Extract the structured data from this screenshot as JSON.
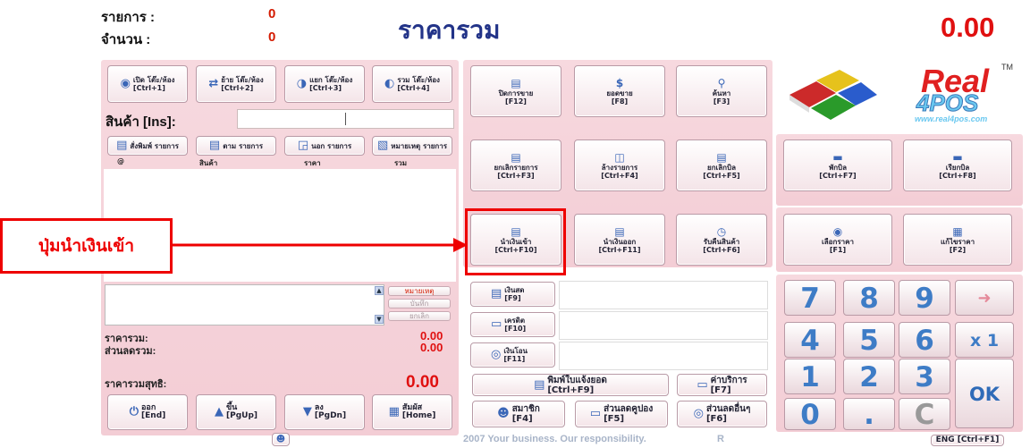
{
  "header": {
    "items_label": "รายการ :",
    "items_value": "0",
    "qty_label": "จำนวน :",
    "qty_value": "0",
    "title": "ราคารวม",
    "total": "0.00"
  },
  "top_buttons": [
    {
      "label": "เปิด โต๊ะ/ห้อง",
      "key": "[Ctrl+1]",
      "icon": "open-table-icon",
      "glyph": "◉"
    },
    {
      "label": "ย้าย โต๊ะ/ห้อง",
      "key": "[Ctrl+2]",
      "icon": "move-table-icon",
      "glyph": "⇄"
    },
    {
      "label": "แยก โต๊ะ/ห้อง",
      "key": "[Ctrl+3]",
      "icon": "split-table-icon",
      "glyph": "◑"
    },
    {
      "label": "รวม โต๊ะ/ห้อง",
      "key": "[Ctrl+4]",
      "icon": "merge-table-icon",
      "glyph": "◐"
    }
  ],
  "product": {
    "label": "สินค้า [Ins]:"
  },
  "list_buttons": [
    {
      "label": "สั่งพิมพ์ รายการ",
      "icon": "print-list-icon",
      "glyph": "▤"
    },
    {
      "label": "ตาม รายการ",
      "icon": "follow-list-icon",
      "glyph": "▤"
    },
    {
      "label": "นอก รายการ",
      "icon": "outside-list-icon",
      "glyph": "◲"
    },
    {
      "label": "หมายเหตุ รายการ",
      "icon": "note-list-icon",
      "glyph": "▧"
    }
  ],
  "columns": [
    "@",
    "สินค้า",
    "ราคา",
    "รวม"
  ],
  "note_buttons": {
    "note": "หมายเหตุ",
    "save": "บันทึก",
    "cancel": "ยกเลิก"
  },
  "summary": {
    "total_label": "ราคารวม:",
    "total": "0.00",
    "discount_label": "ส่วนลดรวม:",
    "discount": "0.00",
    "net_label": "ราคารวมสุทธิ:",
    "net": "0.00"
  },
  "bottom_buttons": [
    {
      "label": "ออก",
      "key": "[End]",
      "icon": "exit-icon",
      "glyph": "⏻"
    },
    {
      "label": "ขึ้น",
      "key": "[PgUp]",
      "icon": "up-arrow-icon",
      "glyph": "▲"
    },
    {
      "label": "ลง",
      "key": "[PgDn]",
      "icon": "down-arrow-icon",
      "glyph": "▼"
    },
    {
      "label": "สัมผัส",
      "key": "[Home]",
      "icon": "touch-icon",
      "glyph": "▦"
    }
  ],
  "function_rows": [
    [
      {
        "label": "ปิดการขาย",
        "key": "[F12]",
        "icon": "close-sale-icon",
        "glyph": "▤"
      },
      {
        "label": "ยอดขาย",
        "key": "[F8]",
        "icon": "sales-total-icon",
        "glyph": "$"
      },
      {
        "label": "ค้นหา",
        "key": "[F3]",
        "icon": "search-icon",
        "glyph": "⚲"
      }
    ],
    [
      {
        "label": "ยกเลิกรายการ",
        "key": "[Ctrl+F3]",
        "icon": "cancel-item-icon",
        "glyph": "▤"
      },
      {
        "label": "ล้างรายการ",
        "key": "[Ctrl+F4]",
        "icon": "clear-list-icon",
        "glyph": "◫"
      },
      {
        "label": "ยกเลิกบิล",
        "key": "[Ctrl+F5]",
        "icon": "cancel-bill-icon",
        "glyph": "▤"
      }
    ],
    [
      {
        "label": "นำเงินเข้า",
        "key": "[Ctrl+F10]",
        "icon": "cash-in-icon",
        "glyph": "▤"
      },
      {
        "label": "นำเงินออก",
        "key": "[Ctrl+F11]",
        "icon": "cash-out-icon",
        "glyph": "▤"
      },
      {
        "label": "รับคืนสินค้า",
        "key": "[Ctrl+F6]",
        "icon": "return-goods-icon",
        "glyph": "◷"
      }
    ]
  ],
  "bill_buttons": [
    {
      "label": "พักบิล",
      "key": "[Ctrl+F7]",
      "icon": "hold-bill-icon",
      "glyph": "▬"
    },
    {
      "label": "เรียกบิล",
      "key": "[Ctrl+F8]",
      "icon": "recall-bill-icon",
      "glyph": "▬"
    }
  ],
  "price_buttons": [
    {
      "label": "เลือกราคา",
      "key": "[F1]",
      "icon": "choose-price-icon",
      "glyph": "◉"
    },
    {
      "label": "แก้ไขราคา",
      "key": "[F2]",
      "icon": "edit-price-icon",
      "glyph": "▦"
    }
  ],
  "payments": [
    {
      "label": "เงินสด",
      "key": "[F9]",
      "icon": "cash-icon",
      "glyph": "▤"
    },
    {
      "label": "เครดิต",
      "key": "[F10]",
      "icon": "credit-card-icon",
      "glyph": "▭"
    },
    {
      "label": "เงินโอน",
      "key": "[F11]",
      "icon": "transfer-icon",
      "glyph": "◎"
    }
  ],
  "extra": {
    "print_label": "พิมพ์ใบแจ้งยอด",
    "print_key": "[Ctrl+F9]",
    "service_label": "ค่าบริการ",
    "service_key": "[F7]",
    "member_label": "สมาชิก",
    "member_key": "[F4]",
    "coupon_label": "ส่วนลดคูปอง",
    "coupon_key": "[F5]",
    "other_label": "ส่วนลดอื่นๆ",
    "other_key": "[F6]"
  },
  "keypad": {
    "k7": "7",
    "k8": "8",
    "k9": "9",
    "back": "➜",
    "k4": "4",
    "k5": "5",
    "k6": "6",
    "x1": "x 1",
    "k1": "1",
    "k2": "2",
    "k3": "3",
    "ok": "OK",
    "k0": "0",
    "dot": ".",
    "clear": "C"
  },
  "logo": {
    "text1": "Real",
    "text2": "4POS",
    "tm": "TM",
    "url": "www.real4pos.com"
  },
  "footer": {
    "text": "2007 Your business. Our responsibility.",
    "r": "R",
    "lang": "ENG [Ctrl+F1]"
  },
  "annotation": {
    "label": "ปุ่มนำเงินเข้า"
  },
  "colors": {
    "accent_red": "#e01010",
    "title_blue": "#223388",
    "panel_pink": "#f5d3da",
    "keypad_blue": "#3e7cc6"
  }
}
